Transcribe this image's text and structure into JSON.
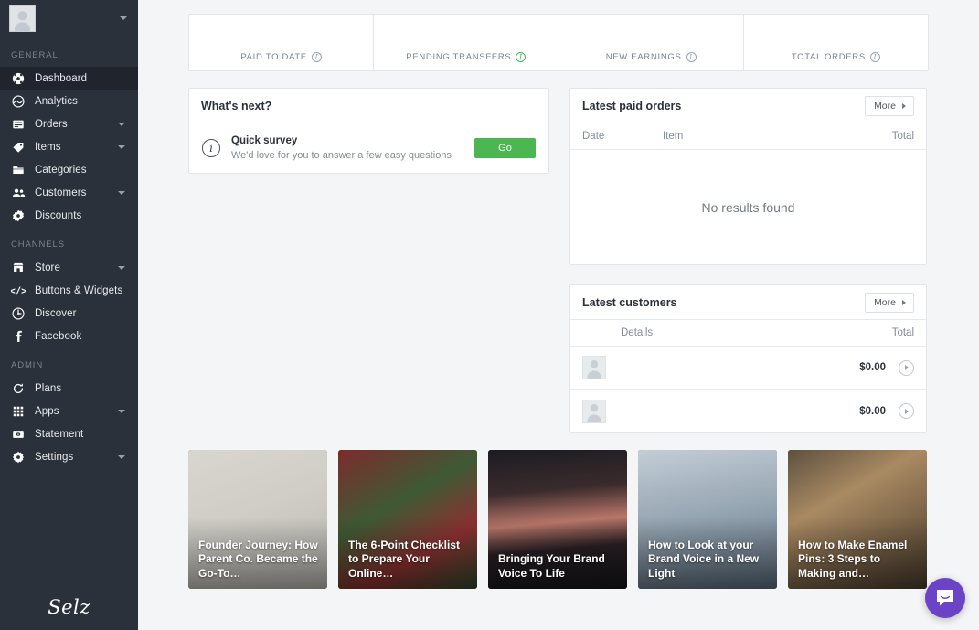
{
  "sidebar": {
    "account": {
      "avatar": "user-avatar",
      "caret": "chevron-down-icon"
    },
    "sections": [
      {
        "title": "GENERAL",
        "items": [
          {
            "label": "Dashboard",
            "icon": "dashboard-icon",
            "active": true,
            "expandable": false
          },
          {
            "label": "Analytics",
            "icon": "analytics-icon",
            "active": false,
            "expandable": false
          },
          {
            "label": "Orders",
            "icon": "orders-icon",
            "active": false,
            "expandable": true
          },
          {
            "label": "Items",
            "icon": "tag-icon",
            "active": false,
            "expandable": true
          },
          {
            "label": "Categories",
            "icon": "folder-icon",
            "active": false,
            "expandable": false
          },
          {
            "label": "Customers",
            "icon": "customers-icon",
            "active": false,
            "expandable": true
          },
          {
            "label": "Discounts",
            "icon": "discount-icon",
            "active": false,
            "expandable": false
          }
        ]
      },
      {
        "title": "CHANNELS",
        "items": [
          {
            "label": "Store",
            "icon": "store-icon",
            "active": false,
            "expandable": true
          },
          {
            "label": "Buttons & Widgets",
            "icon": "code-icon",
            "active": false,
            "expandable": false
          },
          {
            "label": "Discover",
            "icon": "discover-icon",
            "active": false,
            "expandable": false
          },
          {
            "label": "Facebook",
            "icon": "facebook-icon",
            "active": false,
            "expandable": false
          }
        ]
      },
      {
        "title": "ADMIN",
        "items": [
          {
            "label": "Plans",
            "icon": "refresh-icon",
            "active": false,
            "expandable": false
          },
          {
            "label": "Apps",
            "icon": "apps-grid-icon",
            "active": false,
            "expandable": true
          },
          {
            "label": "Statement",
            "icon": "statement-icon",
            "active": false,
            "expandable": false
          },
          {
            "label": "Settings",
            "icon": "gear-icon",
            "active": false,
            "expandable": true
          }
        ]
      }
    ],
    "logo": "Selz"
  },
  "stats": [
    {
      "label": "PAID TO DATE",
      "value": "",
      "info_icon": "info-icon",
      "info_highlight": false
    },
    {
      "label": "PENDING TRANSFERS",
      "value": "",
      "info_icon": "info-icon",
      "info_highlight": true
    },
    {
      "label": "NEW EARNINGS",
      "value": "",
      "info_icon": "info-icon",
      "info_highlight": false
    },
    {
      "label": "TOTAL ORDERS",
      "value": "",
      "info_icon": "info-icon",
      "info_highlight": false
    }
  ],
  "whats_next": {
    "title": "What's next?",
    "item": {
      "icon": "info-icon",
      "title": "Quick survey",
      "subtitle": "We'd love for you to answer a few easy questions",
      "action_label": "Go"
    }
  },
  "latest_paid_orders": {
    "title": "Latest paid orders",
    "more_label": "More",
    "columns": {
      "date": "Date",
      "item": "Item",
      "total": "Total"
    },
    "rows": [],
    "empty_text": "No results found"
  },
  "latest_customers": {
    "title": "Latest customers",
    "more_label": "More",
    "columns": {
      "details": "Details",
      "total": "Total"
    },
    "rows": [
      {
        "name": "",
        "total": "$0.00",
        "avatar": "customer-avatar"
      },
      {
        "name": "",
        "total": "$0.00",
        "avatar": "customer-avatar"
      }
    ]
  },
  "articles": [
    {
      "title": "Founder Journey: How Parent Co. Became the Go-To…",
      "image": "laptop-and-plant-photo"
    },
    {
      "title": "The 6-Point Checklist to Prepare Your Online…",
      "image": "christmas-ornaments-photo"
    },
    {
      "title": "Bringing Your Brand Voice To Life",
      "image": "night-city-lights-photo"
    },
    {
      "title": "How to Look at your Brand Voice in a New Light",
      "image": "person-climbing-tower-photo"
    },
    {
      "title": "How to Make Enamel Pins: 3 Steps to Making and…",
      "image": "desk-coffee-sketchbook-photo"
    }
  ],
  "chat": {
    "label": "intercom-chat",
    "color": "#6a43c6"
  },
  "colors": {
    "sidebar_bg": "#2b313b",
    "sidebar_active": "#20252d",
    "page_bg": "#f4f5f6",
    "accent_green": "#4cb751",
    "card_border": "#e3e6e9",
    "text_dark": "#2b313b",
    "text_muted": "#848d97",
    "chat_purple": "#6a43c6"
  }
}
